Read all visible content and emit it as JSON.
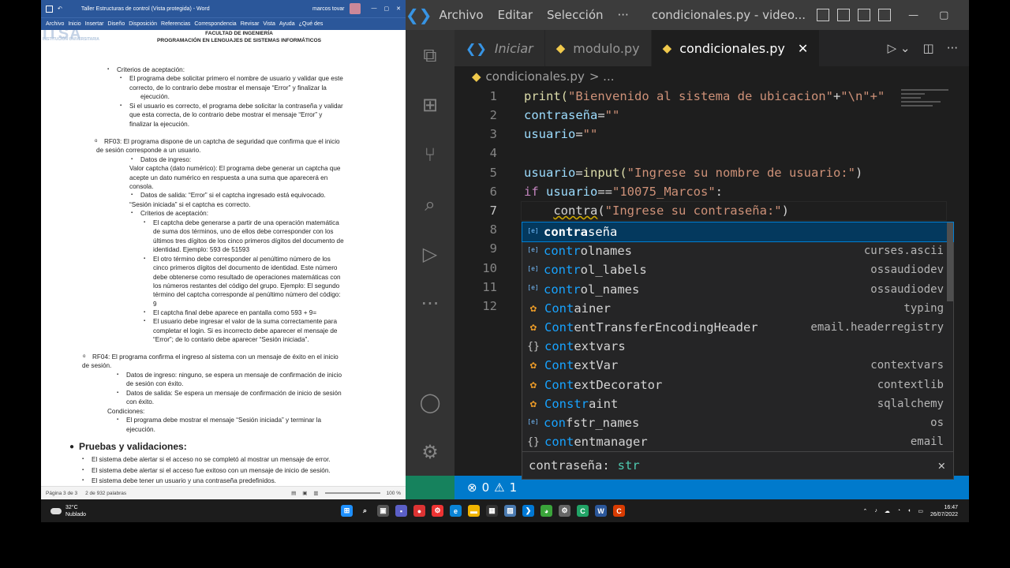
{
  "word": {
    "title": "Taller Estructuras de control (Vista protegida)  -  Word",
    "user": "marcos tovar",
    "ribbon_tabs": [
      "Archivo",
      "Inicio",
      "Insertar",
      "Diseño",
      "Disposición",
      "Referencias",
      "Correspondencia",
      "Revisar",
      "Vista",
      "Ayuda",
      "¿Qué des"
    ],
    "logo": "ITSA",
    "logo_sub": "INSTITUCIÓN UNIVERSITARIA",
    "header_line1": "FACULTAD DE INGENIERÍA",
    "header_line2": "PROGRAMACIÓN EN LENGUAJES DE SISTEMAS INFORMÁTICOS",
    "lines": [
      "Criterios de aceptación:",
      "El programa debe solicitar primero el nombre de usuario y validar que este",
      "correcto, de lo contrario debe mostrar el mensaje “Error” y finalizar la",
      "ejecución.",
      "Si el usuario es correcto, el programa debe solicitar la contraseña y validar",
      "que esta correcta, de lo contrario debe mostrar el mensaje “Error” y",
      "finalizar la ejecución.",
      "RF03: El programa dispone de un captcha de seguridad que confirma que el inicio",
      "de sesión corresponde a un usuario.",
      "Datos de ingreso:",
      "Valor captcha (dato numérico): El programa debe generar un captcha que",
      "acepte un dato numérico en respuesta a una suma que aparecerá en",
      "consola.",
      "Datos de salida: “Error” si el captcha ingresado está equivocado.",
      "“Sesión iniciada” si el captcha es correcto.",
      "Criterios de aceptación:",
      "El captcha debe generarse a partir de una operación matemática",
      "de suma dos términos, uno de ellos debe corresponder con los",
      "últimos tres dígitos de los cinco primeros dígitos del documento de",
      "identidad. Ejemplo: 593 de 51593",
      "El otro término debe corresponder al penúltimo número de los",
      "cinco primeros dígitos del documento de identidad. Este número",
      "debe obtenerse como resultado de operaciones matemáticas con",
      "los números restantes del código del grupo. Ejemplo: El segundo",
      "término del captcha corresponde al penúltimo número del código:",
      "9",
      "El captcha final debe aparece en pantalla como 593 + 9=",
      "El usuario debe ingresar el valor de la suma correctamente para",
      "completar el login. Si es incorrecto debe aparecer el mensaje de",
      "“Error”; de lo contario debe aparecer “Sesión iniciada”.",
      "RF04: El programa confirma el ingreso al sistema con un mensaje de éxito en el inicio",
      "de sesión.",
      "Datos de ingreso: ninguno, se espera un mensaje de confirmación de inicio",
      "de sesión con éxito.",
      "Datos de salida: Se espera un mensaje de confirmación de inicio de sesión",
      "con éxito.",
      "Condiciones:",
      "El programa debe mostrar el mensaje “Sesión iniciada” y terminar la",
      "ejecución.",
      "Pruebas y validaciones:",
      "El sistema debe alertar si el acceso no se completó al mostrar un mensaje de error.",
      "El sistema debe alertar si el acceso fue exitoso con un mensaje de inicio de sesión.",
      "El sistema debe tener un usuario y una contraseña predefinidos."
    ],
    "status_page": "Página 3 de 3",
    "status_words": "2 de 932 palabras",
    "zoom": "100 %"
  },
  "vscode": {
    "menus": [
      "Archivo",
      "Editar",
      "Selección",
      "···"
    ],
    "window_title": "condicionales.py - video...",
    "tabs": [
      {
        "label": "Iniciar"
      },
      {
        "label": "modulo.py"
      },
      {
        "label": "condicionales.py"
      }
    ],
    "breadcrumb_file": "condicionales.py",
    "breadcrumb_rest": "> ...",
    "code": {
      "l1": [
        "print(",
        "\"Bienvenido al sistema de ubicacion\"",
        "+",
        "\"\\n\"",
        "+\""
      ],
      "l2": [
        "contraseña",
        "=",
        "\"\""
      ],
      "l3": [
        "usuario",
        "=",
        "\"\""
      ],
      "l5": [
        "usuario",
        "=",
        "input(",
        "\"Ingrese su nombre de usuario:\"",
        ")"
      ],
      "l6": [
        "if ",
        "usuario",
        "==",
        "\"10075_Marcos\"",
        ":"
      ],
      "l7": [
        "    ",
        "contra",
        "(",
        "\"Ingrese su contraseña:\"",
        ")"
      ]
    },
    "line_numbers": [
      "1",
      "2",
      "3",
      "4",
      "5",
      "6",
      "7",
      "8",
      "9",
      "10",
      "11",
      "12"
    ],
    "suggestions": [
      {
        "pre": "",
        "hl": "contra",
        "post": "seña",
        "detail": "",
        "icon": "variable"
      },
      {
        "pre": "",
        "hl": "contr",
        "post": "olnames",
        "detail": "curses.ascii",
        "icon": "variable"
      },
      {
        "pre": "",
        "hl": "contr",
        "post": "ol_labels",
        "detail": "ossaudiodev",
        "icon": "variable"
      },
      {
        "pre": "",
        "hl": "contr",
        "post": "ol_names",
        "detail": "ossaudiodev",
        "icon": "variable"
      },
      {
        "pre": "",
        "hl": "Cont",
        "post": "ainer",
        "detail": "typing",
        "icon": "class"
      },
      {
        "pre": "",
        "hl": "Cont",
        "post": "entTransferEncodingHeader",
        "detail": "email.headerregistry",
        "icon": "class"
      },
      {
        "pre": "",
        "hl": "cont",
        "post": "extvars",
        "detail": "",
        "icon": "module"
      },
      {
        "pre": "",
        "hl": "Cont",
        "post": "extVar",
        "detail": "contextvars",
        "icon": "class"
      },
      {
        "pre": "",
        "hl": "Cont",
        "post": "extDecorator",
        "detail": "contextlib",
        "icon": "class"
      },
      {
        "pre": "",
        "hl": "Constr",
        "post": "aint",
        "detail": "sqlalchemy",
        "icon": "class"
      },
      {
        "pre": "",
        "hl": "con",
        "post": "fstr_names",
        "detail": "os",
        "icon": "variable"
      },
      {
        "pre": "",
        "hl": "cont",
        "post": "entmanager",
        "detail": "email",
        "icon": "module"
      }
    ],
    "detail_name": "contraseña:",
    "detail_type": "str",
    "status_errors": "0",
    "status_warnings": "1"
  },
  "taskbar": {
    "temp": "32°C",
    "weather": "Nublado",
    "time": "16:47",
    "date": "26/07/2022"
  }
}
